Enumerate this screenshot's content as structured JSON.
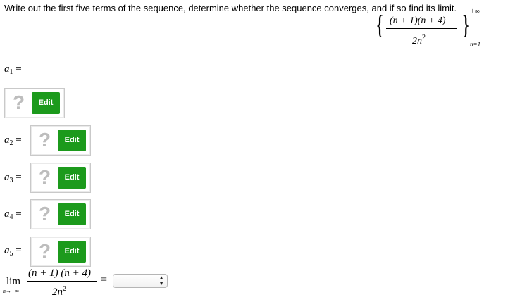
{
  "instruction": "Write out the first five terms of the sequence, determine whether the sequence converges, and if so find its limit.",
  "sequence": {
    "numerator": "(n + 1)(n + 4)",
    "denominator_base": "2n",
    "denominator_exp": "2",
    "upper": "+∞",
    "lower": "n=1"
  },
  "terms": [
    {
      "var": "a",
      "sub": "1",
      "eq": "=",
      "placeholder": "?",
      "edit_label": "Edit"
    },
    {
      "var": "a",
      "sub": "2",
      "eq": "=",
      "placeholder": "?",
      "edit_label": "Edit"
    },
    {
      "var": "a",
      "sub": "3",
      "eq": "=",
      "placeholder": "?",
      "edit_label": "Edit"
    },
    {
      "var": "a",
      "sub": "4",
      "eq": "=",
      "placeholder": "?",
      "edit_label": "Edit"
    },
    {
      "var": "a",
      "sub": "5",
      "eq": "=",
      "placeholder": "?",
      "edit_label": "Edit"
    }
  ],
  "limit": {
    "word": "lim",
    "sub": "n→+∞",
    "numerator": "(n + 1) (n + 4)",
    "denominator_base": "2n",
    "denominator_exp": "2",
    "eq": "=",
    "select_value": ""
  },
  "colors": {
    "edit_button": "#1c9a1c",
    "placeholder_mark": "#bdbdbd"
  }
}
